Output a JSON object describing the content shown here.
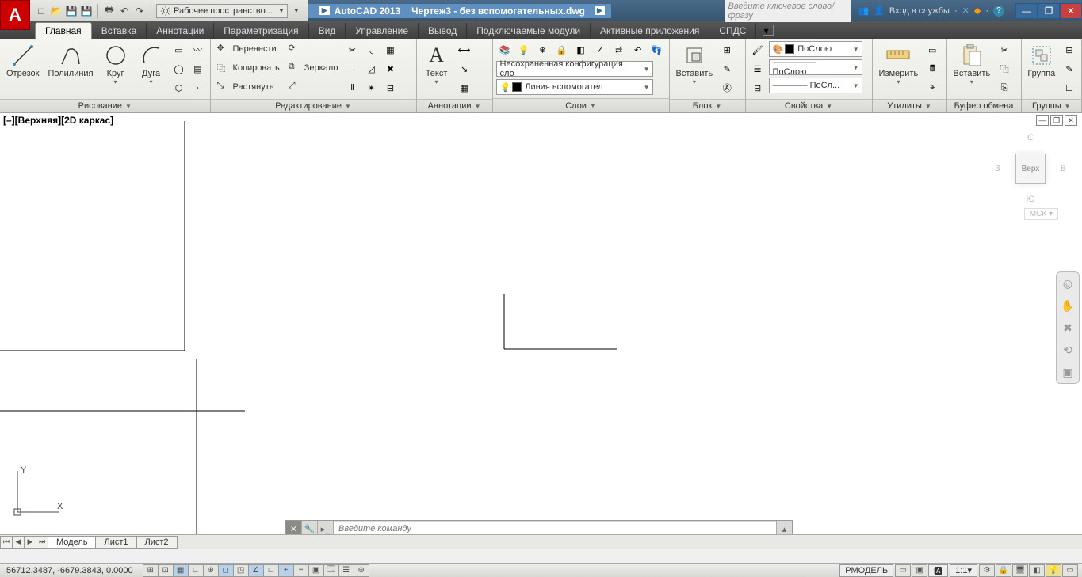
{
  "title": {
    "app": "AutoCAD 2013",
    "file": "Чертеж3 - без вспомогательных.dwg"
  },
  "qat_workspace": "Рабочее пространство...",
  "search_placeholder": "Введите ключевое слово/фразу",
  "signin": "Вход в службы",
  "tabs": [
    "Главная",
    "Вставка",
    "Аннотации",
    "Параметризация",
    "Вид",
    "Управление",
    "Вывод",
    "Подключаемые модули",
    "Активные приложения",
    "СПДС"
  ],
  "panels": {
    "draw": {
      "title": "Рисование",
      "items": [
        "Отрезок",
        "Полилиния",
        "Круг",
        "Дуга"
      ]
    },
    "modify": {
      "title": "Редактирование",
      "items": [
        "Перенести",
        "Копировать",
        "Растянуть",
        "Зеркало"
      ]
    },
    "anno": {
      "title": "Аннотации",
      "text": "Текст"
    },
    "layers": {
      "title": "Слои",
      "combo": "Несохраненная конфигурация сло",
      "current": "Линия вспомогател"
    },
    "block": {
      "title": "Блок",
      "insert": "Вставить"
    },
    "props": {
      "title": "Свойства",
      "bylayer": "ПоСлою",
      "lt": "————— ПоСлою",
      "lw": "———— ПоСл..."
    },
    "util": {
      "title": "Утилиты",
      "measure": "Измерить"
    },
    "clip": {
      "title": "Буфер обмена",
      "paste": "Вставить"
    },
    "group": {
      "title": "Группы",
      "group": "Группа"
    }
  },
  "viewport_label": "[–][Верхняя][2D каркас]",
  "viewcube": {
    "face": "Верх",
    "n": "С",
    "s": "Ю",
    "e": "В",
    "w": "З",
    "wcs": "МСК"
  },
  "cmd_placeholder": "Введите команду",
  "layout_tabs": [
    "Модель",
    "Лист1",
    "Лист2"
  ],
  "status": {
    "coords": "56712.3487, -6679.3843, 0.0000",
    "model": "РМОДЕЛЬ",
    "scale": "1:1"
  }
}
